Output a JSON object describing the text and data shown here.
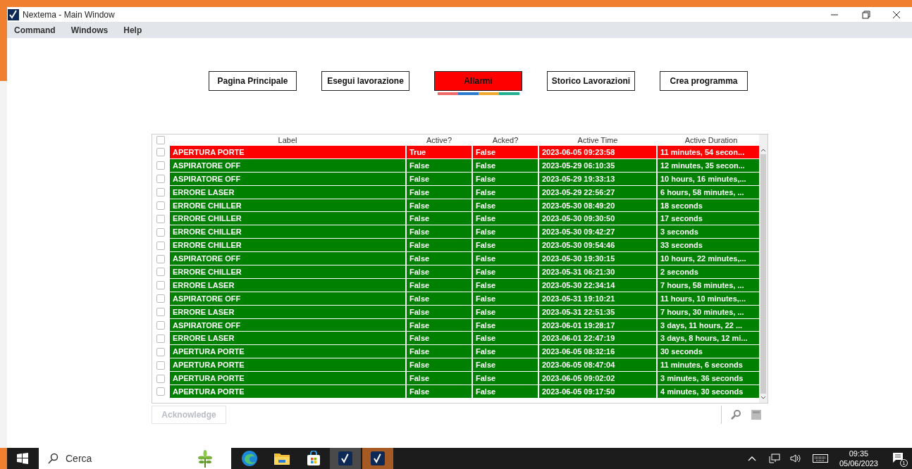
{
  "window": {
    "title": "Nextema - Main Window"
  },
  "menu": [
    {
      "label": "Command"
    },
    {
      "label": "Windows"
    },
    {
      "label": "Help"
    }
  ],
  "tabs": [
    {
      "label": "Pagina Principale",
      "selected": false
    },
    {
      "label": "Esegui lavorazione",
      "selected": false
    },
    {
      "label": "Allarmi",
      "selected": true
    },
    {
      "label": "Storico Lavorazioni",
      "selected": false
    },
    {
      "label": "Crea programma",
      "selected": false
    }
  ],
  "table": {
    "select_all_checked": false,
    "columns": [
      "Label",
      "Active?",
      "Acked?",
      "Active Time",
      "Active Duration"
    ],
    "rows": [
      {
        "checked": false,
        "color": "#ff0000",
        "cells": [
          "APERTURA PORTE",
          "True",
          "False",
          "2023-06-05 09:23:58",
          "11 minutes, 54 secon..."
        ]
      },
      {
        "checked": false,
        "color": "#008000",
        "cells": [
          "ASPIRATORE OFF",
          "False",
          "False",
          "2023-05-29 06:10:35",
          "12 minutes, 35 secon..."
        ]
      },
      {
        "checked": false,
        "color": "#008000",
        "cells": [
          "ASPIRATORE OFF",
          "False",
          "False",
          "2023-05-29 19:33:13",
          "10 hours, 16 minutes,..."
        ]
      },
      {
        "checked": false,
        "color": "#008000",
        "cells": [
          "ERRORE LASER",
          "False",
          "False",
          "2023-05-29 22:56:27",
          "6 hours, 58 minutes, ..."
        ]
      },
      {
        "checked": false,
        "color": "#008000",
        "cells": [
          "ERRORE CHILLER",
          "False",
          "False",
          "2023-05-30 08:49:20",
          "18 seconds"
        ]
      },
      {
        "checked": false,
        "color": "#008000",
        "cells": [
          "ERRORE CHILLER",
          "False",
          "False",
          "2023-05-30 09:30:50",
          "17 seconds"
        ]
      },
      {
        "checked": false,
        "color": "#008000",
        "cells": [
          "ERRORE CHILLER",
          "False",
          "False",
          "2023-05-30 09:42:27",
          "3 seconds"
        ]
      },
      {
        "checked": false,
        "color": "#008000",
        "cells": [
          "ERRORE CHILLER",
          "False",
          "False",
          "2023-05-30 09:54:46",
          "33 seconds"
        ]
      },
      {
        "checked": false,
        "color": "#008000",
        "cells": [
          "ASPIRATORE OFF",
          "False",
          "False",
          "2023-05-30 19:30:15",
          "10 hours, 22 minutes,..."
        ]
      },
      {
        "checked": false,
        "color": "#008000",
        "cells": [
          "ERRORE CHILLER",
          "False",
          "False",
          "2023-05-31 06:21:30",
          "2 seconds"
        ]
      },
      {
        "checked": false,
        "color": "#008000",
        "cells": [
          "ERRORE LASER",
          "False",
          "False",
          "2023-05-30 22:34:14",
          "7 hours, 58 minutes, ..."
        ]
      },
      {
        "checked": false,
        "color": "#008000",
        "cells": [
          "ASPIRATORE OFF",
          "False",
          "False",
          "2023-05-31 19:10:21",
          "11 hours, 10 minutes,..."
        ]
      },
      {
        "checked": false,
        "color": "#008000",
        "cells": [
          "ERRORE LASER",
          "False",
          "False",
          "2023-05-31 22:51:35",
          "7 hours, 30 minutes, ..."
        ]
      },
      {
        "checked": false,
        "color": "#008000",
        "cells": [
          "ASPIRATORE OFF",
          "False",
          "False",
          "2023-06-01 19:28:17",
          "3 days, 11 hours, 22 ..."
        ]
      },
      {
        "checked": false,
        "color": "#008000",
        "cells": [
          "ERRORE LASER",
          "False",
          "False",
          "2023-06-01 22:47:19",
          "3 days, 8 hours, 12 mi..."
        ]
      },
      {
        "checked": false,
        "color": "#008000",
        "cells": [
          "APERTURA PORTE",
          "False",
          "False",
          "2023-06-05 08:32:16",
          "30 seconds"
        ]
      },
      {
        "checked": false,
        "color": "#008000",
        "cells": [
          "APERTURA PORTE",
          "False",
          "False",
          "2023-06-05 08:47:04",
          "11 minutes, 6 seconds"
        ]
      },
      {
        "checked": false,
        "color": "#008000",
        "cells": [
          "APERTURA PORTE",
          "False",
          "False",
          "2023-06-05 09:02:02",
          "3 minutes, 36 seconds"
        ]
      },
      {
        "checked": false,
        "color": "#008000",
        "cells": [
          "APERTURA PORTE",
          "False",
          "False",
          "2023-06-05 09:17:50",
          "4 minutes, 30 seconds"
        ]
      }
    ]
  },
  "acknowledge_button": {
    "label": "Acknowledge",
    "disabled": true
  },
  "taskbar": {
    "search_placeholder": "Cerca",
    "time": "09:35",
    "date": "05/06/2023",
    "notification_count": "1"
  }
}
